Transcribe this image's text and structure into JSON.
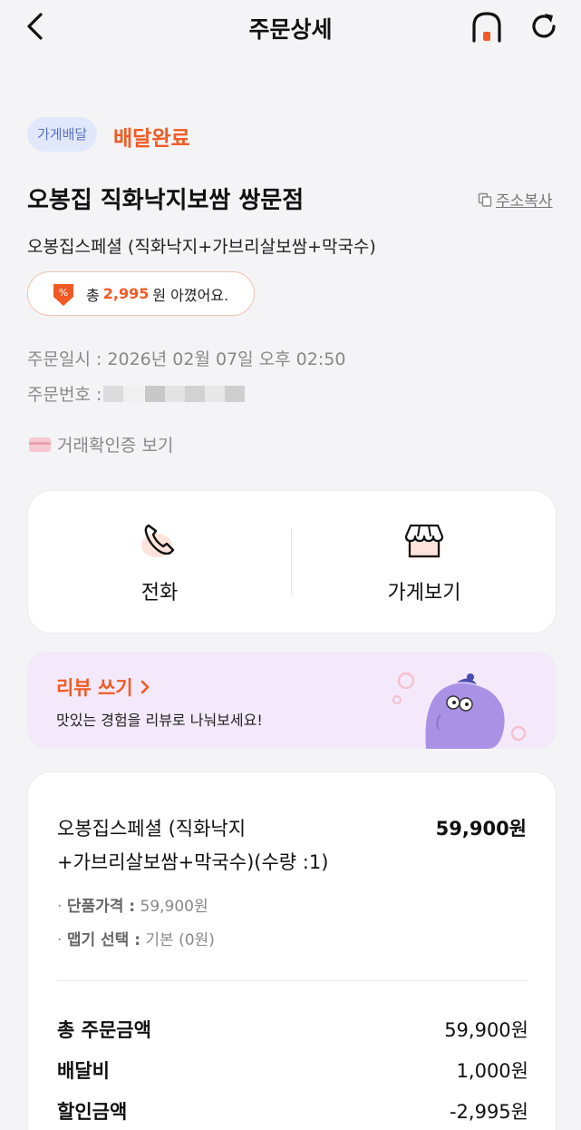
{
  "header": {
    "title": "주문상세",
    "back_icon": "chevron-left-icon",
    "home_icon": "home-icon",
    "refresh_icon": "refresh-icon"
  },
  "order": {
    "badge": "가게배달",
    "status": "배달완료",
    "store_name": "오봉집 직화낙지보쌈 쌍문점",
    "copy_address_label": "주소복사",
    "menu_summary": "오봉집스페셜 (직화낙지+가브리살보쌈+막국수)",
    "savings": {
      "prefix": "총",
      "amount": "2,995",
      "suffix": "원 아꼈어요."
    },
    "order_date": "주문일시 : 2026년 02월 07일 오후 02:50",
    "order_number_label": "주문번호 :",
    "receipt_label": "거래확인증 보기"
  },
  "actions": {
    "call_label": "전화",
    "store_label": "가게보기"
  },
  "review": {
    "title": "리뷰 쓰기",
    "subtitle": "맛있는 경험을 리뷰로 나눠보세요!"
  },
  "detail": {
    "item_name_line1": "오봉집스페셜 (직화낙지",
    "item_name_line2": "+가브리살보쌈+막국수)(수량 :1)",
    "item_price": "59,900원",
    "unit_price_label": "단품가격 :",
    "unit_price_value": "59,900원",
    "spice_label": "맵기 선택 :",
    "spice_value": "기본 (0원)",
    "total_label": "총 주문금액",
    "total_value": "59,900원",
    "delivery_label": "배달비",
    "delivery_value": "1,000원",
    "discount_label": "할인금액",
    "discount_value": "-2,995원"
  },
  "colors": {
    "accent": "#f15a24",
    "badge_bg": "#e1e8fb",
    "badge_text": "#5a72c9",
    "review_bg": "#f3e9fa",
    "mascot": "#a992e6"
  }
}
